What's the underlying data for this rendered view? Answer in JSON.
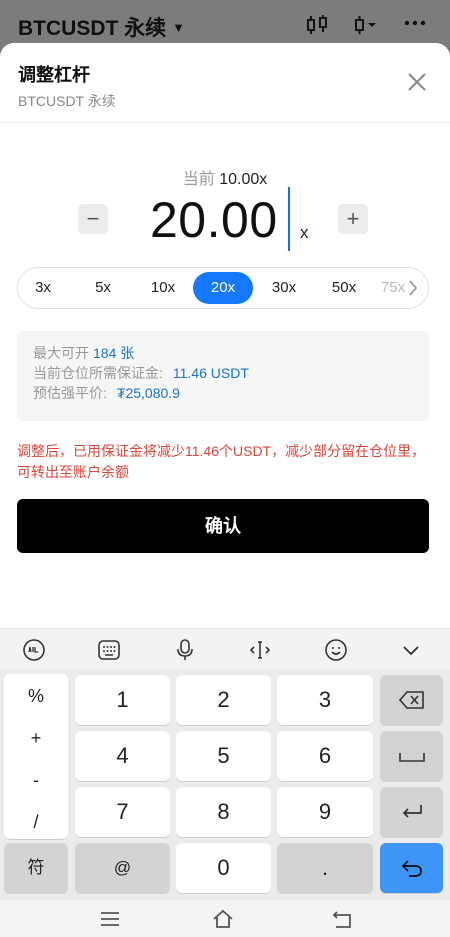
{
  "topbar": {
    "symbol": "BTCUSDT 永续"
  },
  "sheet": {
    "title": "调整杠杆",
    "subtitle": "BTCUSDT 永续",
    "current_label": "当前",
    "current_value": "10.00x",
    "leverage_value": "20.00",
    "leverage_unit": "x",
    "minus": "−",
    "plus": "+",
    "presets": [
      "3x",
      "5x",
      "10x",
      "20x",
      "30x",
      "50x",
      "75x"
    ],
    "active_preset": "20x",
    "info": {
      "max_open_label": "最大可开",
      "max_open_value": "184 张",
      "margin_label": "当前仓位所需保证金:",
      "margin_value": "11.46 USDT",
      "liq_label": "预估强平价:",
      "liq_value": "₮25,080.9"
    },
    "warning": "调整后，已用保证金将减少11.46个USDT，减少部分留在仓位里，可转出至账户余额",
    "confirm_label": "确认"
  },
  "keyboard": {
    "symbols": [
      "%",
      "+",
      "-",
      "/"
    ],
    "digits": [
      "1",
      "2",
      "3",
      "4",
      "5",
      "6",
      "7",
      "8",
      "9",
      "0"
    ],
    "fu_label": "符",
    "at_label": "@",
    "dot_label": "."
  },
  "colors": {
    "accent": "#1677ff",
    "warning": "#d9463c",
    "info_value": "#1a73c9",
    "confirm_bg": "#000000"
  }
}
